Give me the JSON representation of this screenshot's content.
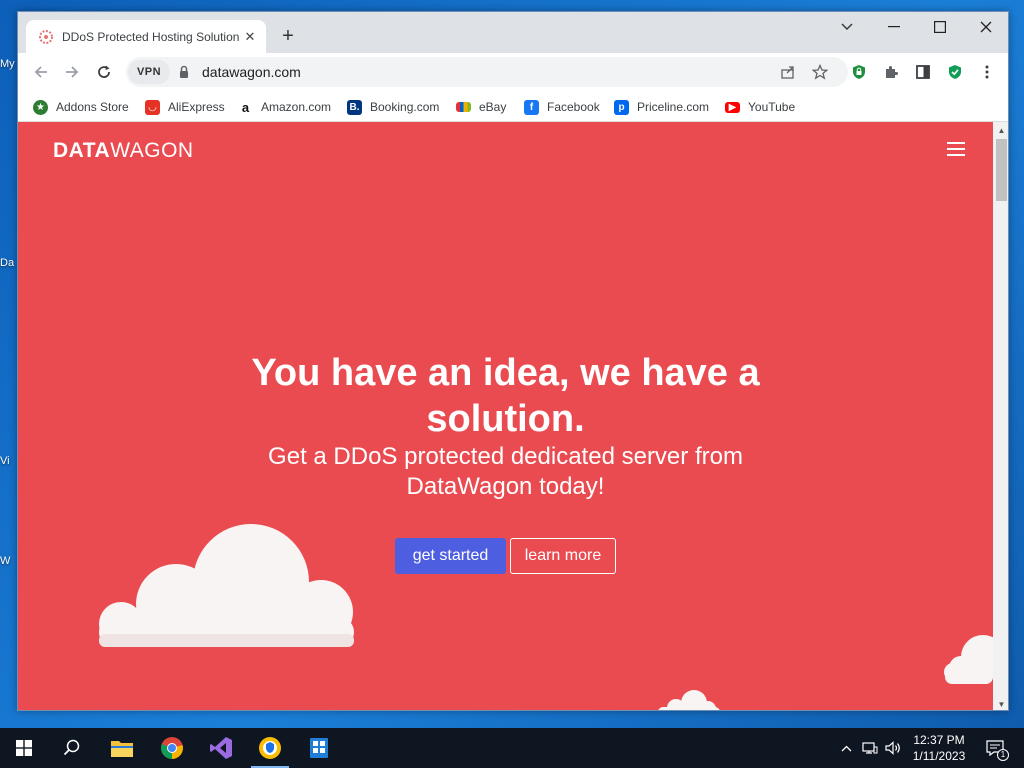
{
  "desktop": {
    "fragments": [
      "My",
      "Da",
      "Vi",
      "W"
    ]
  },
  "browser": {
    "tab": {
      "title": "DDoS Protected Hosting Solution",
      "close": "✕"
    },
    "new_tab": "+",
    "window_controls": {
      "minimize": "—",
      "maximize": "☐",
      "close": "✕",
      "dropdown": "⌄"
    },
    "vpn_label": "VPN",
    "url": "datawagon.com",
    "bookmarks": [
      {
        "label": "Addons Store",
        "icon": "addons-store-icon",
        "color": "#2e7d32"
      },
      {
        "label": "AliExpress",
        "icon": "aliexpress-icon",
        "color": "#e43225"
      },
      {
        "label": "Amazon.com",
        "icon": "amazon-icon",
        "color": "#ffffff"
      },
      {
        "label": "Booking.com",
        "icon": "booking-icon",
        "color": "#003580"
      },
      {
        "label": "eBay",
        "icon": "ebay-icon",
        "color": "#ffffff"
      },
      {
        "label": "Facebook",
        "icon": "facebook-icon",
        "color": "#1877f2"
      },
      {
        "label": "Priceline.com",
        "icon": "priceline-icon",
        "color": "#0068ef"
      },
      {
        "label": "YouTube",
        "icon": "youtube-icon",
        "color": "#ff0000"
      }
    ]
  },
  "page": {
    "logo_bold": "DATA",
    "logo_light": "WAGON",
    "hero_title": "You have an idea, we have a solution.",
    "hero_subtitle": "Get a DDoS protected dedicated server from DataWagon today!",
    "primary_cta": "get started",
    "secondary_cta": "learn more",
    "colors": {
      "background": "#ea4b50",
      "primary_button": "#4e5ee0",
      "cloud": "#f8f4f4"
    }
  },
  "taskbar": {
    "time": "12:37 PM",
    "date": "1/11/2023",
    "notification_count": "1",
    "apps": [
      "start-icon",
      "search-icon",
      "file-explorer-icon",
      "chrome-icon",
      "visual-studio-icon",
      "browser-app-icon",
      "store-app-icon"
    ]
  }
}
